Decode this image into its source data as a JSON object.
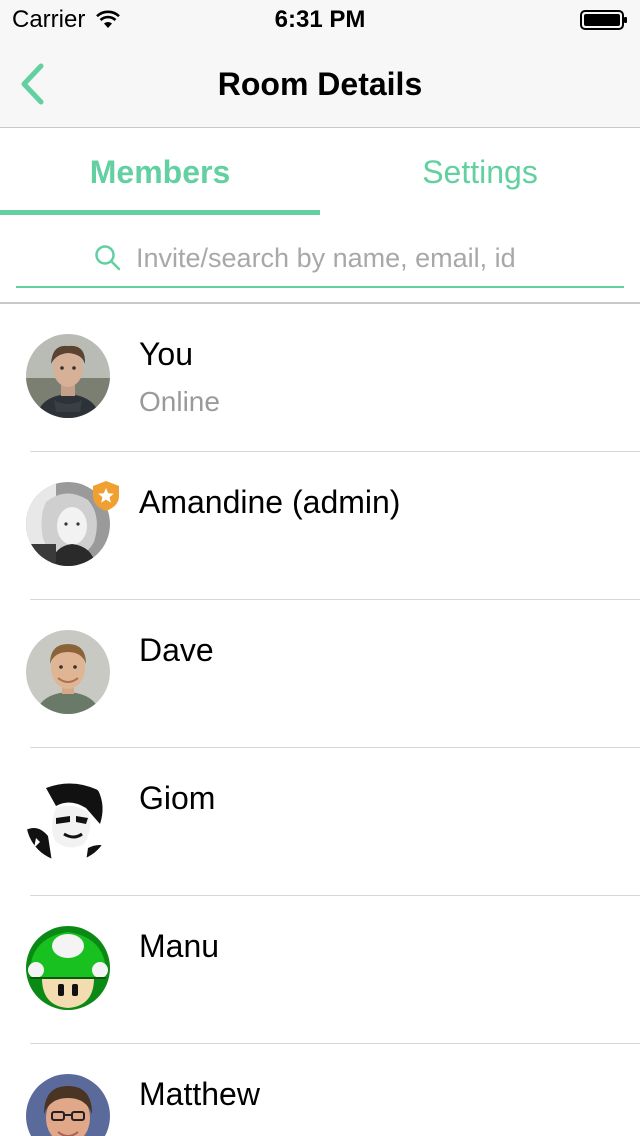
{
  "status_bar": {
    "carrier": "Carrier",
    "time": "6:31 PM",
    "wifi_icon": "wifi-icon",
    "battery_icon": "battery-icon"
  },
  "nav": {
    "title": "Room Details",
    "back_icon": "chevron-left-icon"
  },
  "tabs": [
    {
      "label": "Members",
      "active": true
    },
    {
      "label": "Settings",
      "active": false
    }
  ],
  "search": {
    "placeholder": "Invite/search by name, email, id",
    "icon": "search-icon"
  },
  "members": [
    {
      "name": "You",
      "status": "Online",
      "admin": false
    },
    {
      "name": "Amandine (admin)",
      "status": "",
      "admin": true
    },
    {
      "name": "Dave",
      "status": "",
      "admin": false
    },
    {
      "name": "Giom",
      "status": "",
      "admin": false
    },
    {
      "name": "Manu",
      "status": "",
      "admin": false
    },
    {
      "name": "Matthew",
      "status": "",
      "admin": false
    }
  ],
  "colors": {
    "accent": "#62d0a0",
    "admin_badge": "#f0a030",
    "secondary_text": "#9a9a9a"
  }
}
